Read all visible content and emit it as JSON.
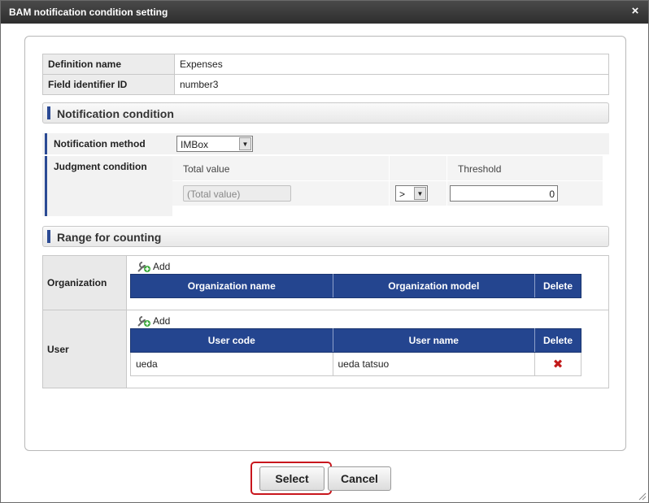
{
  "window": {
    "title": "BAM notification condition setting",
    "close_icon": "×"
  },
  "info": {
    "definition_name_label": "Definition name",
    "definition_name_value": "Expenses",
    "field_id_label": "Field identifier ID",
    "field_id_value": "number3"
  },
  "notification": {
    "section_title": "Notification condition",
    "method_label": "Notification method",
    "method_value": "IMBox",
    "judgment_label": "Judgment condition",
    "total_value_header": "Total value",
    "total_value_placeholder": "(Total value)",
    "operator_value": ">",
    "threshold_header": "Threshold",
    "threshold_value": "0"
  },
  "range": {
    "section_title": "Range for counting",
    "organization": {
      "label": "Organization",
      "add_label": "Add",
      "columns": [
        "Organization name",
        "Organization model",
        "Delete"
      ],
      "rows": []
    },
    "user": {
      "label": "User",
      "add_label": "Add",
      "columns": [
        "User code",
        "User name",
        "Delete"
      ],
      "rows": [
        {
          "code": "ueda",
          "name": "ueda tatsuo"
        }
      ]
    }
  },
  "buttons": {
    "select_label": "Select",
    "cancel_label": "Cancel"
  },
  "colors": {
    "header_blue": "#24458f",
    "accent_red": "#c8161d",
    "titlebar": "#3a3a3a"
  }
}
